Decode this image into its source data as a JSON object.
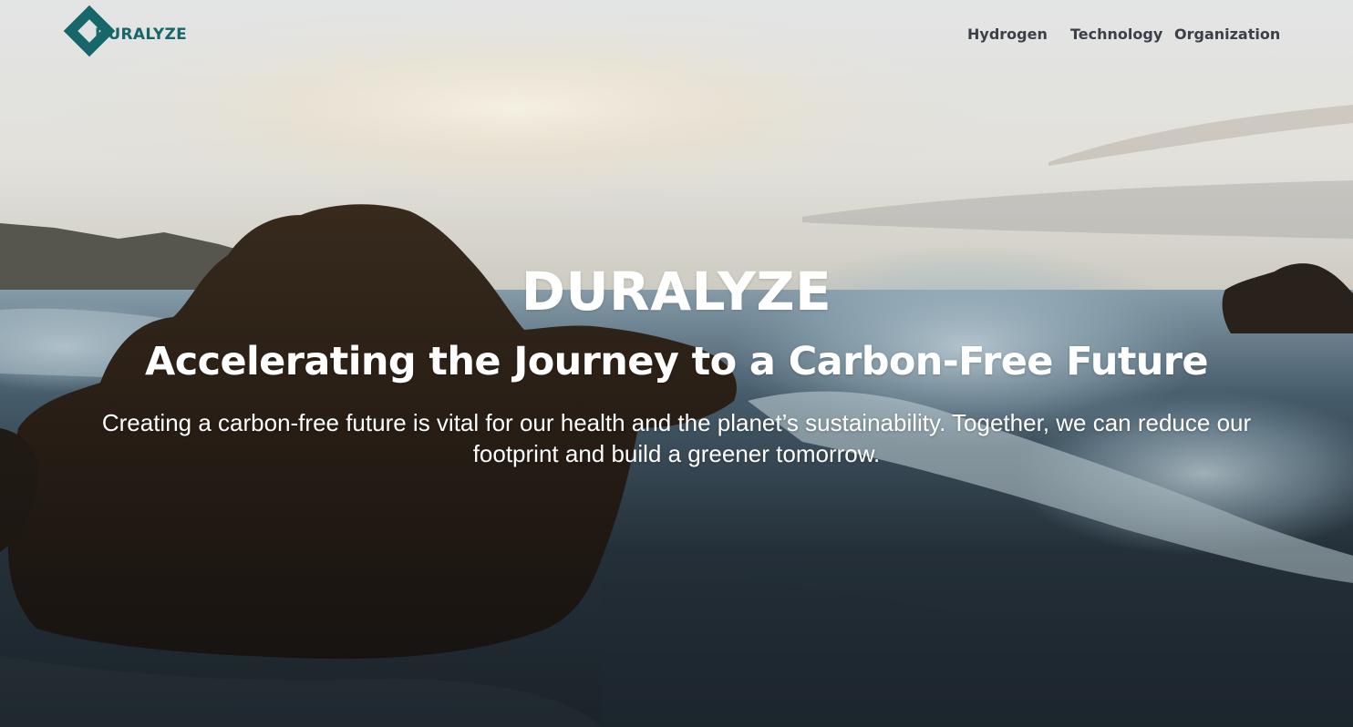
{
  "header": {
    "logo_text": "DURALYZE",
    "nav": [
      {
        "label": "Hydrogen"
      },
      {
        "label": "Technology"
      },
      {
        "label": "Organization"
      }
    ]
  },
  "hero": {
    "brand": "DURALYZE",
    "headline": "Accelerating the Journey to a Carbon-Free Future",
    "subtext": "Creating a carbon-free future is vital for our health and the planet’s sustainability. Together, we can reduce our footprint and build a greener tomorrow."
  },
  "colors": {
    "brand_teal": "#17676a",
    "nav_text": "#3a3f48",
    "hero_text": "#ffffff"
  },
  "icons": {
    "logo": "duralyze-diamond-logo-icon"
  }
}
